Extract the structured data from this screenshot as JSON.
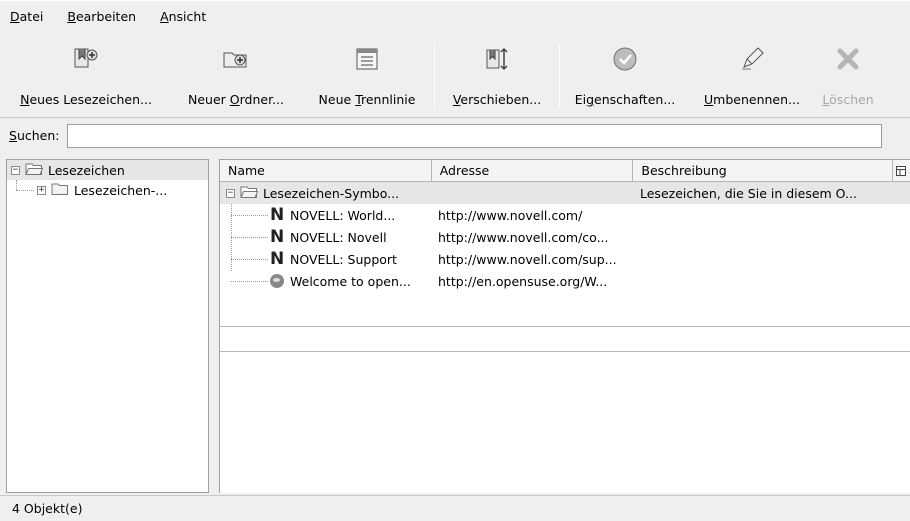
{
  "menu": [
    {
      "pre": "",
      "accel": "D",
      "post": "atei"
    },
    {
      "pre": "",
      "accel": "B",
      "post": "earbeiten"
    },
    {
      "pre": "",
      "accel": "A",
      "post": "nsicht"
    }
  ],
  "toolbar": {
    "new_bookmark": {
      "pre": "",
      "accel": "N",
      "post": "eues Lesezeichen..."
    },
    "new_folder": {
      "pre": "Neuer ",
      "accel": "O",
      "post": "rdner..."
    },
    "new_separator": {
      "pre": "Neue ",
      "accel": "T",
      "post": "rennlinie"
    },
    "move": {
      "pre": "",
      "accel": "V",
      "post": "erschieben..."
    },
    "properties": {
      "pre": "Ei",
      "accel": "g",
      "post": "enschaften..."
    },
    "rename": {
      "pre": "",
      "accel": "U",
      "post": "mbenennen..."
    },
    "delete": {
      "pre": "",
      "accel": "L",
      "post": "öschen"
    }
  },
  "search": {
    "label_accel": "S",
    "label_post": "uchen:",
    "value": "",
    "placeholder": ""
  },
  "tree": {
    "root_expander": "−",
    "root_label": "Lesezeichen",
    "child_expander": "+",
    "child_label": "Lesezeichen-..."
  },
  "list": {
    "columns": [
      "Name",
      "Adresse",
      "Beschreibung"
    ],
    "folder": {
      "expander": "−",
      "name": "Lesezeichen-Symbo...",
      "address": "",
      "description": "Lesezeichen, die Sie in diesem O..."
    },
    "items": [
      {
        "icon": "N",
        "name": "NOVELL: World...",
        "address": "http://www.novell.com/"
      },
      {
        "icon": "N",
        "name": "NOVELL: Novell",
        "address": "http://www.novell.com/co..."
      },
      {
        "icon": "N",
        "name": "NOVELL: Support",
        "address": "http://www.novell.com/sup..."
      },
      {
        "icon": "opensuse",
        "name": "Welcome to open...",
        "address": "http://en.opensuse.org/W..."
      }
    ]
  },
  "status": {
    "text": "4 Objekt(e)"
  }
}
